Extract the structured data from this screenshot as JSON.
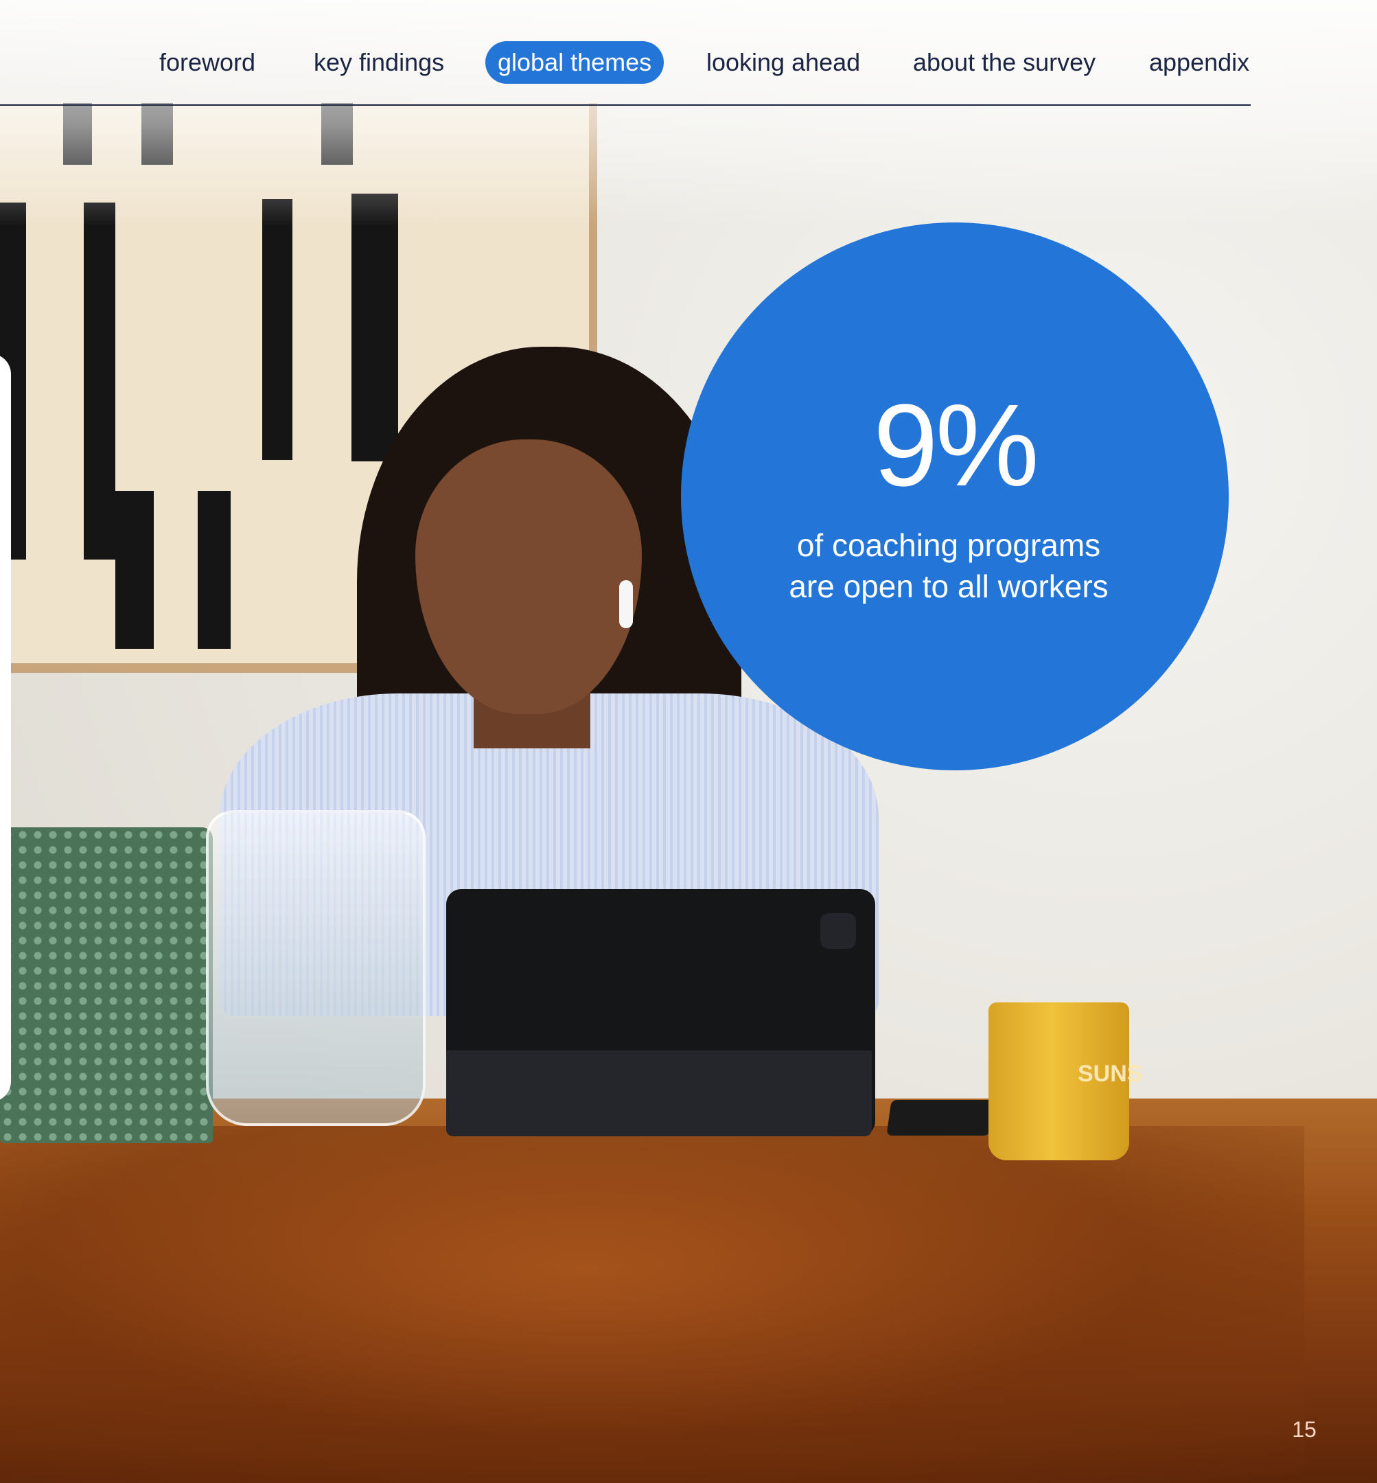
{
  "nav": {
    "items": [
      {
        "label": "foreword",
        "active": false
      },
      {
        "label": "key findings",
        "active": false
      },
      {
        "label": "global themes",
        "active": true
      },
      {
        "label": "looking ahead",
        "active": false
      },
      {
        "label": "about the survey",
        "active": false
      },
      {
        "label": "appendix",
        "active": false
      }
    ]
  },
  "stat": {
    "value": "9%",
    "caption_line1": "of coaching programs",
    "caption_line2": "are open to all workers"
  },
  "photo": {
    "mug_text": "SUNS"
  },
  "page_number": "15",
  "colors": {
    "accent": "#2475d8",
    "nav_text": "#1b2543",
    "table_wood": "#9a4f19"
  }
}
